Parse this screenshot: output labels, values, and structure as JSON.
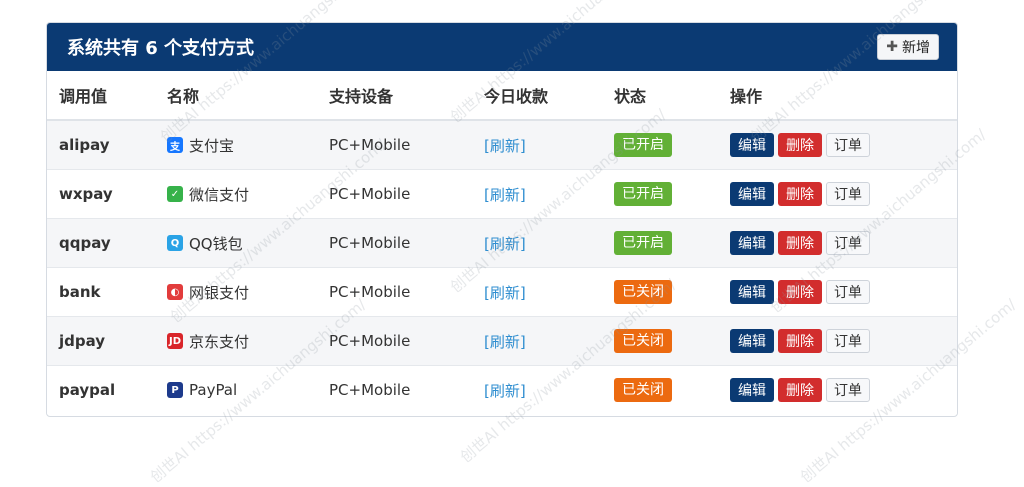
{
  "header": {
    "title": "系统共有 6 个支付方式",
    "add_label": "新增"
  },
  "columns": [
    "调用值",
    "名称",
    "支持设备",
    "今日收款",
    "状态",
    "操作"
  ],
  "rows": [
    {
      "code": "alipay",
      "name": "支付宝",
      "icon": "alipay-icon",
      "icon_glyph": "支",
      "icon_color": "#1677ff",
      "device": "PC+Mobile",
      "today": "[刷新]",
      "status": "已开启",
      "status_color": "#62b036",
      "edit": "编辑",
      "del": "删除",
      "order": "订单"
    },
    {
      "code": "wxpay",
      "name": "微信支付",
      "icon": "wechat-icon",
      "icon_glyph": "✓",
      "icon_color": "#36b24a",
      "device": "PC+Mobile",
      "today": "[刷新]",
      "status": "已开启",
      "status_color": "#62b036",
      "edit": "编辑",
      "del": "删除",
      "order": "订单"
    },
    {
      "code": "qqpay",
      "name": "QQ钱包",
      "icon": "qq-icon",
      "icon_glyph": "Q",
      "icon_color": "#2aa3e6",
      "device": "PC+Mobile",
      "today": "[刷新]",
      "status": "已开启",
      "status_color": "#62b036",
      "edit": "编辑",
      "del": "删除",
      "order": "订单"
    },
    {
      "code": "bank",
      "name": "网银支付",
      "icon": "unionpay-icon",
      "icon_glyph": "◐",
      "icon_color": "#e23c3c",
      "device": "PC+Mobile",
      "today": "[刷新]",
      "status": "已关闭",
      "status_color": "#ec6a10",
      "edit": "编辑",
      "del": "删除",
      "order": "订单"
    },
    {
      "code": "jdpay",
      "name": "京东支付",
      "icon": "jd-icon",
      "icon_glyph": "JD",
      "icon_color": "#d9252a",
      "device": "PC+Mobile",
      "today": "[刷新]",
      "status": "已关闭",
      "status_color": "#ec6a10",
      "edit": "编辑",
      "del": "删除",
      "order": "订单"
    },
    {
      "code": "paypal",
      "name": "PayPal",
      "icon": "paypal-icon",
      "icon_glyph": "P",
      "icon_color": "#1d3a8c",
      "device": "PC+Mobile",
      "today": "[刷新]",
      "status": "已关闭",
      "status_color": "#ec6a10",
      "edit": "编辑",
      "del": "删除",
      "order": "订单"
    }
  ],
  "watermark": "创世AI https://www.aichuangshi.com/"
}
